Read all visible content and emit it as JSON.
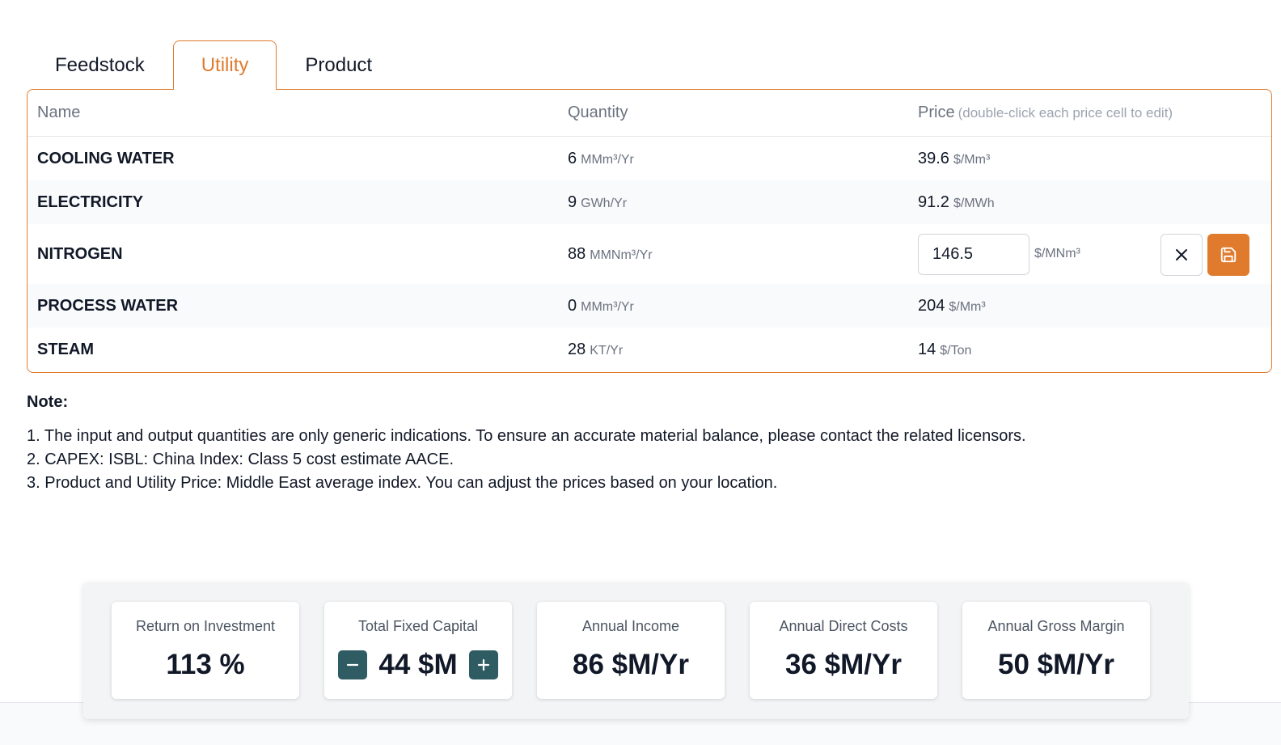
{
  "tabs": [
    {
      "label": "Feedstock",
      "active": false
    },
    {
      "label": "Utility",
      "active": true
    },
    {
      "label": "Product",
      "active": false
    }
  ],
  "table": {
    "headers": {
      "name": "Name",
      "quantity": "Quantity",
      "price": "Price",
      "price_hint": "(double-click each price cell to edit)"
    },
    "rows": [
      {
        "name": "COOLING WATER",
        "quantity": "6",
        "quantity_unit": "MMm³/Yr",
        "price": "39.6",
        "price_unit": "$/Mm³"
      },
      {
        "name": "ELECTRICITY",
        "quantity": "9",
        "quantity_unit": "GWh/Yr",
        "price": "91.2",
        "price_unit": "$/MWh"
      },
      {
        "name": "NITROGEN",
        "quantity": "88",
        "quantity_unit": "MMNm³/Yr",
        "price": "146.5",
        "price_unit": "$/MNm³",
        "editing": true
      },
      {
        "name": "PROCESS WATER",
        "quantity": "0",
        "quantity_unit": "MMm³/Yr",
        "price": "204",
        "price_unit": "$/Mm³"
      },
      {
        "name": "STEAM",
        "quantity": "28",
        "quantity_unit": "KT/Yr",
        "price": "14",
        "price_unit": "$/Ton"
      }
    ]
  },
  "notes": {
    "title": "Note:",
    "items": [
      "1. The input and output quantities are only generic indications. To ensure an accurate material balance, please contact the related licensors.",
      "2. CAPEX: ISBL: China Index: Class 5 cost estimate AACE.",
      "3. Product and Utility Price: Middle East average index. You can adjust the prices based on your location."
    ]
  },
  "summary": {
    "roi": {
      "label": "Return on Investment",
      "value": "113 %"
    },
    "tfc": {
      "label": "Total Fixed Capital",
      "value": "44 $M"
    },
    "income": {
      "label": "Annual Income",
      "value": "86 $M/Yr"
    },
    "direct_costs": {
      "label": "Annual Direct Costs",
      "value": "36 $M/Yr"
    },
    "gross_margin": {
      "label": "Annual Gross Margin",
      "value": "50 $M/Yr"
    }
  },
  "colors": {
    "accent": "#e07b2e",
    "stepper": "#2f5b63"
  },
  "icons": {
    "cancel": "close-icon",
    "save": "save-icon",
    "decrement": "minus-icon",
    "increment": "plus-icon"
  }
}
